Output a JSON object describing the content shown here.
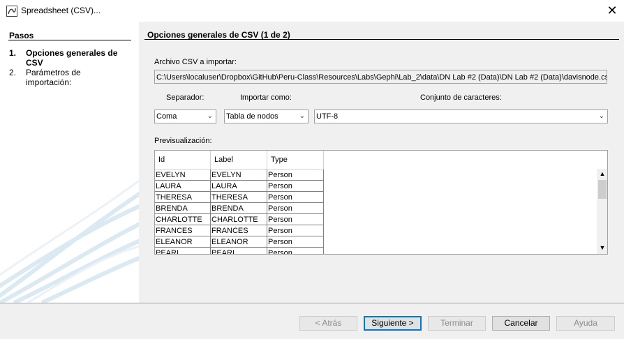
{
  "window": {
    "title": "Spreadsheet (CSV)...",
    "close_glyph": "✕",
    "icon": "app-icon"
  },
  "steps": {
    "title": "Pasos",
    "items": [
      {
        "num": "1.",
        "label": "Opciones generales de CSV",
        "active": true
      },
      {
        "num": "2.",
        "label": "Parámetros de importación:",
        "active": false
      }
    ]
  },
  "content": {
    "header": "Opciones generales de CSV (1 de 2)",
    "file_label": "Archivo CSV a importar:",
    "file_path": "C:\\Users\\localuser\\Dropbox\\GitHub\\Peru-Class\\Resources\\Labs\\Gephi\\Lab_2\\data\\DN Lab #2 (Data)\\DN Lab #2 (Data)\\davisnode.csv",
    "separator_label": "Separador:",
    "separator_value": "Coma",
    "import_as_label": "Importar como:",
    "import_as_value": "Tabla de nodos",
    "charset_label": "Conjunto de caracteres:",
    "charset_value": "UTF-8",
    "preview_label": "Previsualización:",
    "preview": {
      "columns": [
        "Id",
        "Label",
        "Type"
      ],
      "rows": [
        [
          "EVELYN",
          "EVELYN",
          "Person"
        ],
        [
          "LAURA",
          "LAURA",
          "Person"
        ],
        [
          "THERESA",
          "THERESA",
          "Person"
        ],
        [
          "BRENDA",
          "BRENDA",
          "Person"
        ],
        [
          "CHARLOTTE",
          "CHARLOTTE",
          "Person"
        ],
        [
          "FRANCES",
          "FRANCES",
          "Person"
        ],
        [
          "ELEANOR",
          "ELEANOR",
          "Person"
        ],
        [
          "PEARL",
          "PEARL",
          "Person"
        ]
      ]
    }
  },
  "buttons": {
    "back": "< Atrás",
    "next": "Siguiente >",
    "finish": "Terminar",
    "cancel": "Cancelar",
    "help": "Ayuda"
  },
  "colors": {
    "focus": "#0078d7",
    "panel": "#f0f0f0",
    "decor": "#d9e8f2"
  }
}
